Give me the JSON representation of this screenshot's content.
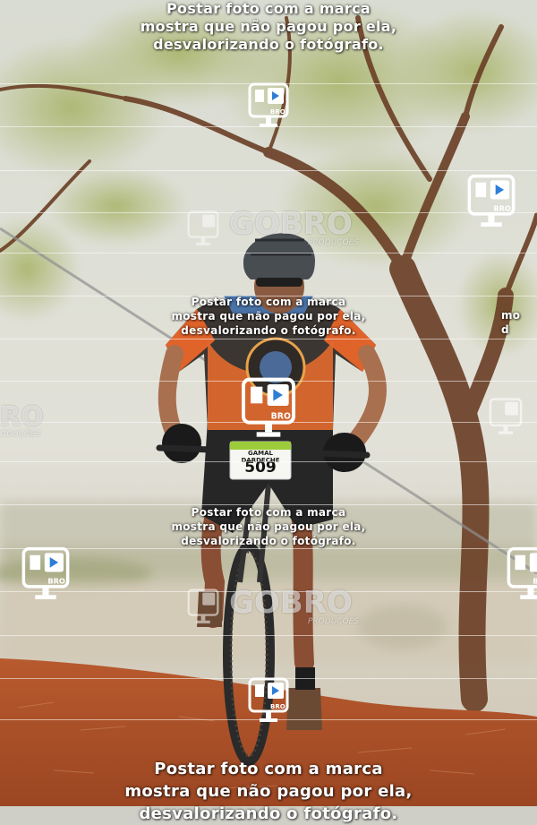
{
  "watermark": {
    "message_line1": "Postar foto com a marca",
    "message_line2": "mostra que não pagou por ela,",
    "message_line3": "desvalorizando o fotógrafo.",
    "edge_fragment_line1": "mo",
    "edge_fragment_line2": "d",
    "brand_name": "GOBRO",
    "brand_sub": "PRODUÇÕES",
    "brand_edge_fragment": "RO",
    "brand_edge_sub": "ODUÇÕES",
    "logo_badge": "BRO"
  },
  "rider": {
    "bib_name": "GAMAL DARDECHE",
    "bib_number": "509"
  },
  "colors": {
    "jersey_orange": "#e0632a",
    "dirt": "#b3552c",
    "sky": "#e4e4dc"
  }
}
